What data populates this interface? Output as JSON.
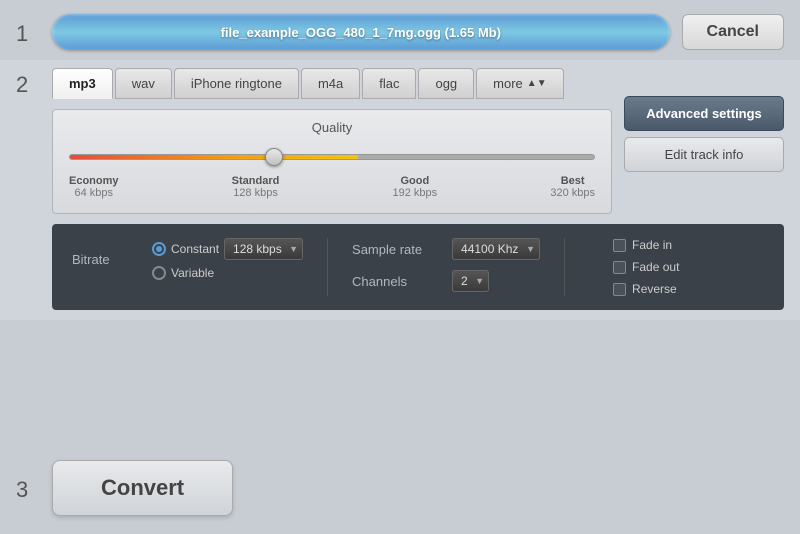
{
  "step1": {
    "number": "1",
    "filename": "file_example_OGG_480_1_7mg.ogg (1.65 Mb)",
    "cancel_label": "Cancel"
  },
  "step2": {
    "number": "2",
    "tabs": [
      {
        "id": "mp3",
        "label": "mp3",
        "active": true
      },
      {
        "id": "wav",
        "label": "wav",
        "active": false
      },
      {
        "id": "iphone",
        "label": "iPhone ringtone",
        "active": false
      },
      {
        "id": "m4a",
        "label": "m4a",
        "active": false
      },
      {
        "id": "flac",
        "label": "flac",
        "active": false
      },
      {
        "id": "ogg",
        "label": "ogg",
        "active": false
      },
      {
        "id": "more",
        "label": "more",
        "active": false
      }
    ],
    "quality": {
      "label": "Quality",
      "markers": [
        {
          "label": "Economy",
          "kbps": "64 kbps"
        },
        {
          "label": "Standard",
          "kbps": "128 kbps"
        },
        {
          "label": "Good",
          "kbps": "192 kbps"
        },
        {
          "label": "Best",
          "kbps": "320 kbps"
        }
      ]
    },
    "advanced_btn": "Advanced settings",
    "edit_btn": "Edit track info",
    "bitrate_label": "Bitrate",
    "constant_label": "Constant",
    "variable_label": "Variable",
    "bitrate_value": "128 kbps",
    "sample_rate_label": "Sample rate",
    "sample_rate_value": "44100 Khz",
    "channels_label": "Channels",
    "channels_value": "2",
    "fade_in_label": "Fade in",
    "fade_out_label": "Fade out",
    "reverse_label": "Reverse"
  },
  "step3": {
    "number": "3",
    "convert_label": "Convert"
  }
}
